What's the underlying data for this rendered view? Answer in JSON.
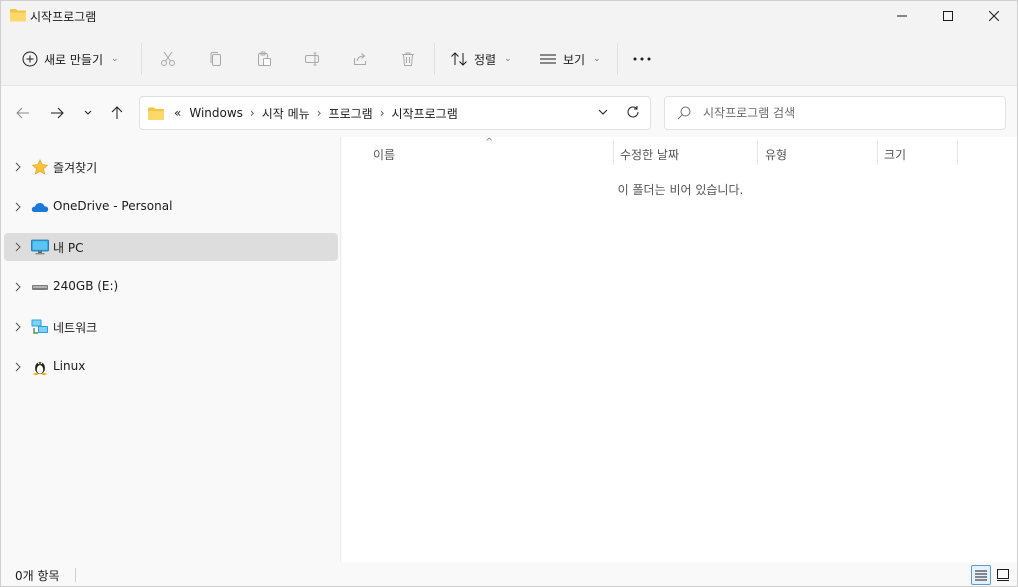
{
  "window": {
    "title": "시작프로그램",
    "controls": [
      "minimize-icon",
      "maximize-icon",
      "close-icon"
    ]
  },
  "toolbar": {
    "new_label": "새로 만들기",
    "sort_label": "정렬",
    "view_label": "보기",
    "icons": [
      "cut-icon",
      "copy-icon",
      "paste-icon",
      "rename-icon",
      "share-icon",
      "delete-icon",
      "more-icon"
    ]
  },
  "address": {
    "overflow": "«",
    "crumbs": [
      "Windows",
      "시작 메뉴",
      "프로그램",
      "시작프로그램"
    ]
  },
  "search": {
    "placeholder": "시작프로그램 검색"
  },
  "sidebar": {
    "items": [
      {
        "label": "즐겨찾기",
        "icon": "star-icon"
      },
      {
        "label": "OneDrive - Personal",
        "icon": "cloud-icon"
      },
      {
        "label": "내 PC",
        "icon": "pc-icon",
        "selected": true
      },
      {
        "label": "240GB (E:)",
        "icon": "drive-icon"
      },
      {
        "label": "네트워크",
        "icon": "network-icon"
      },
      {
        "label": "Linux",
        "icon": "linux-icon"
      }
    ]
  },
  "columns": {
    "name": "이름",
    "modified": "수정한 날짜",
    "type": "유형",
    "size": "크기"
  },
  "main": {
    "empty_message": "이 폴더는 비어 있습니다."
  },
  "status": {
    "item_count": "0개 항목"
  },
  "colors": {
    "folder": "#f4c542",
    "accent": "#0067c0",
    "selected": "#dddddd"
  }
}
